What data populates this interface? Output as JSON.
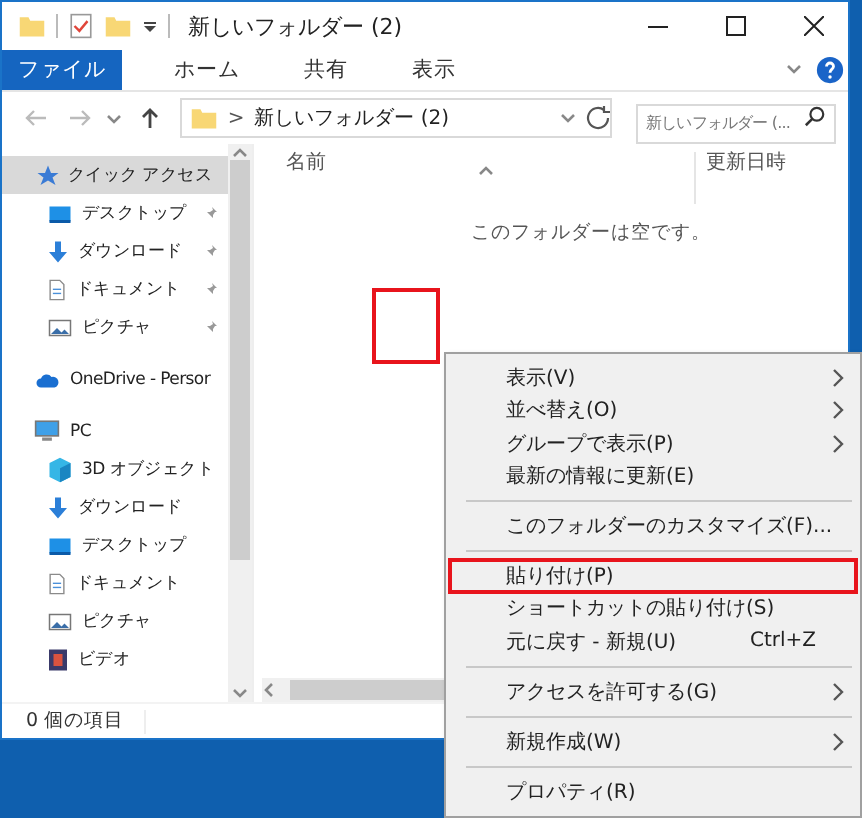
{
  "window": {
    "title": "新しいフォルダー (2)"
  },
  "ribbon_tabs": [
    {
      "label": "ファイル",
      "selected": true
    },
    {
      "label": "ホーム",
      "selected": false
    },
    {
      "label": "共有",
      "selected": false
    },
    {
      "label": "表示",
      "selected": false
    }
  ],
  "address_bar": {
    "separator": ">",
    "path": "新しいフォルダー (2)"
  },
  "search": {
    "placeholder": "新しいフォルダー (..."
  },
  "navigation": [
    {
      "kind": "star",
      "label": "クイック アクセス",
      "selected": true,
      "children": [
        {
          "kind": "desktop",
          "label": "デスクトップ",
          "pinned": true,
          "selected": false
        },
        {
          "kind": "download",
          "label": "ダウンロード",
          "pinned": true,
          "selected": false
        },
        {
          "kind": "document",
          "label": "ドキュメント",
          "pinned": true,
          "selected": false
        },
        {
          "kind": "picture",
          "label": "ピクチャ",
          "pinned": true,
          "selected": false
        }
      ]
    },
    {
      "kind": "cloud",
      "label": "OneDrive - Persor",
      "selected": false
    },
    {
      "kind": "pc",
      "label": "PC",
      "selected": false,
      "children": [
        {
          "kind": "cube",
          "label": "3D オブジェクト",
          "selected": false
        },
        {
          "kind": "download",
          "label": "ダウンロード",
          "selected": false
        },
        {
          "kind": "desktop",
          "label": "デスクトップ",
          "selected": false
        },
        {
          "kind": "document",
          "label": "ドキュメント",
          "selected": false
        },
        {
          "kind": "picture",
          "label": "ピクチャ",
          "selected": false
        },
        {
          "kind": "video",
          "label": "ビデオ",
          "selected": false
        }
      ]
    }
  ],
  "columns": [
    "名前",
    "更新日時"
  ],
  "empty_message": "このフォルダーは空です。",
  "click_marker": true,
  "status_bar": "0 個の項目",
  "context_menu": [
    {
      "kind": "item",
      "label": "表示(V)",
      "submenu": true,
      "highlighted": false
    },
    {
      "kind": "item",
      "label": "並べ替え(O)",
      "submenu": true,
      "highlighted": false
    },
    {
      "kind": "item",
      "label": "グループで表示(P)",
      "submenu": true,
      "highlighted": false
    },
    {
      "kind": "item",
      "label": "最新の情報に更新(E)",
      "submenu": false,
      "highlighted": false
    },
    {
      "kind": "separator"
    },
    {
      "kind": "item",
      "label": "このフォルダーのカスタマイズ(F)...",
      "submenu": false,
      "highlighted": false
    },
    {
      "kind": "separator"
    },
    {
      "kind": "item",
      "label": "貼り付け(P)",
      "submenu": false,
      "highlighted": true
    },
    {
      "kind": "item",
      "label": "ショートカットの貼り付け(S)",
      "submenu": false,
      "highlighted": false
    },
    {
      "kind": "item",
      "label": "元に戻す - 新規(U)",
      "shortcut": "Ctrl+Z",
      "submenu": false,
      "highlighted": false
    },
    {
      "kind": "separator"
    },
    {
      "kind": "item",
      "label": "アクセスを許可する(G)",
      "submenu": true,
      "highlighted": false
    },
    {
      "kind": "separator"
    },
    {
      "kind": "item",
      "label": "新規作成(W)",
      "submenu": true,
      "highlighted": false
    },
    {
      "kind": "separator"
    },
    {
      "kind": "item",
      "label": "プロパティ(R)",
      "submenu": false,
      "highlighted": false
    }
  ]
}
